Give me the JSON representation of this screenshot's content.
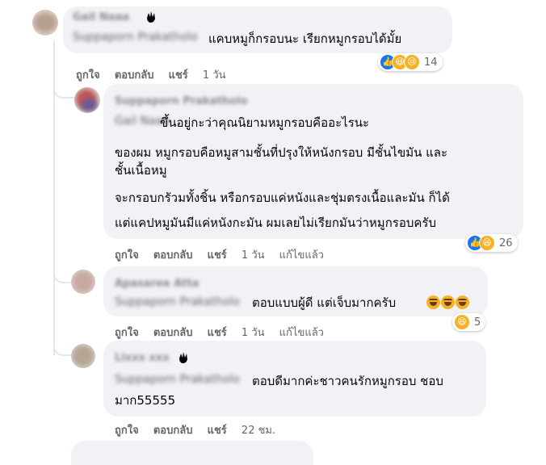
{
  "comments": [
    {
      "author": "Gail Naaa",
      "tagged": "Suppaporn Prakatholo",
      "lines": [
        "แคบหมูก็กรอบนะ เรียกหมูกรอบได้มั้ย"
      ],
      "actions": {
        "like": "ถูกใจ",
        "reply": "ตอบกลับ",
        "share": "แชร์",
        "time": "1 วัน",
        "edited": ""
      },
      "reactions": {
        "types": [
          "like",
          "haha",
          "sad"
        ],
        "count": "14"
      }
    },
    {
      "author": "Suppaporn Prakatholo",
      "tagged": "Gail Naaa",
      "lines": [
        "ขึ้นอยู่กะว่าคุณนิยามหมูกรอบคืออะไรนะ",
        "ของผม หมูกรอบคือหมูสามชั้นที่ปรุงให้หนังกรอบ มีชั้นไขมัน และ",
        "ชั้นเนื้อหมู",
        "จะกรอบกรัวมทั้งชิ้น หรือกรอบแค่หนังและชุ่มตรงเนื้อและมัน ก็ได้",
        "แต่แคปหมูมันมีแค่หนังกะมัน ผมเลยไม่เรียกมันว่าหมูกรอบครับ"
      ],
      "actions": {
        "like": "ถูกใจ",
        "reply": "ตอบกลับ",
        "share": "แชร์",
        "time": "1 วัน",
        "edited": "แก้ไขแล้ว"
      },
      "reactions": {
        "types": [
          "like",
          "haha"
        ],
        "count": "26"
      }
    },
    {
      "author": "Apasaree Atta",
      "tagged": "Suppaporn Prakatholo",
      "lines": [
        "ตอบแบบผู้ดี แต่เจ็บมากครับ"
      ],
      "actions": {
        "like": "ถูกใจ",
        "reply": "ตอบกลับ",
        "share": "แชร์",
        "time": "1 วัน",
        "edited": "แก้ไขแล้ว"
      },
      "reactions": {
        "types": [
          "haha"
        ],
        "count": "5"
      }
    },
    {
      "author": "Lixxx xxx",
      "tagged": "Suppaporn Prakatholo",
      "lines": [
        "ตอบดีมากค่ะชาวคนรักหมูกรอบ ชอบ",
        "มาก55555"
      ],
      "actions": {
        "like": "ถูกใจ",
        "reply": "ตอบกลับ",
        "share": "แชร์",
        "time": "22 ชม.",
        "edited": ""
      }
    }
  ],
  "colors": {
    "bubble": "#f0f2f5",
    "like": "#1877f2",
    "haha": "#f7b125",
    "meta": "#65676b"
  }
}
